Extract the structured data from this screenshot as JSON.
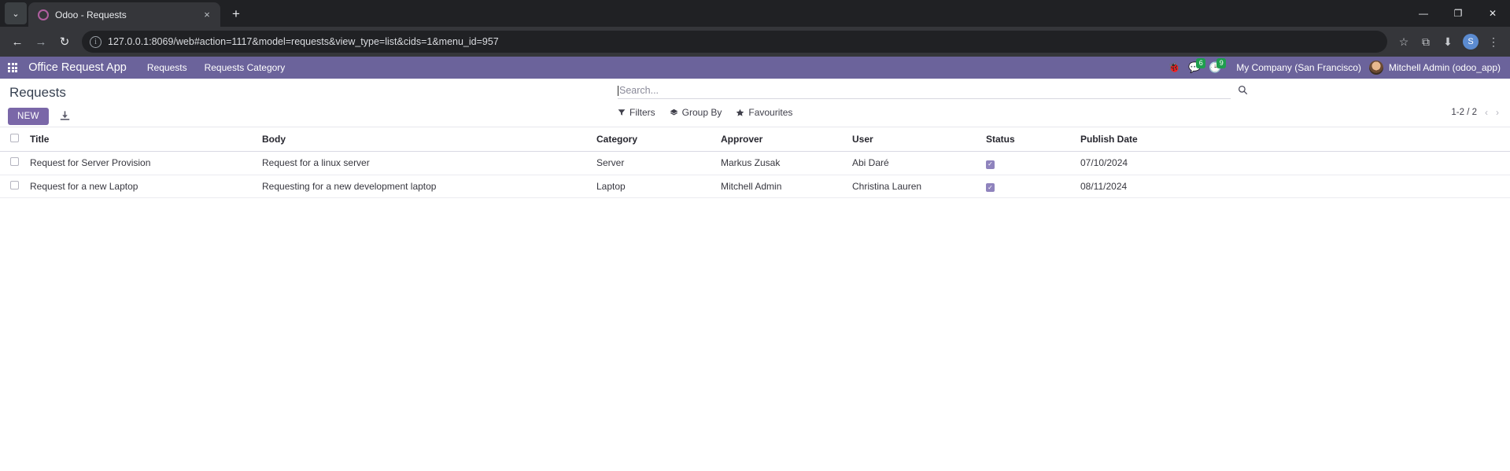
{
  "browser": {
    "tab": {
      "title": "Odoo - Requests",
      "favicon": "odoo-favicon",
      "close": "×"
    },
    "new_tab": "+",
    "tab_list": "⌄",
    "nav": {
      "back": "←",
      "forward": "→",
      "reload": "↻"
    },
    "omnibox": {
      "info_icon": "i",
      "url": "127.0.0.1:8069/web#action=1117&model=requests&view_type=list&cids=1&menu_id=957"
    },
    "toolbar_icons": {
      "bookmark": "☆",
      "extensions": "⧉",
      "download": "⬇"
    },
    "profile_initial": "S",
    "menu": "⋮",
    "window": {
      "minimize": "—",
      "maximize": "❐",
      "close": "✕"
    }
  },
  "navbar": {
    "apps_icon": "apps-grid-icon",
    "brand": "Office Request App",
    "menu_items": [
      "Requests",
      "Requests Category"
    ],
    "sys_icons": [
      {
        "name": "bug-icon",
        "glyph": "🐞",
        "badge": null
      },
      {
        "name": "messages-icon",
        "glyph": "💬",
        "badge": "6"
      },
      {
        "name": "activities-icon",
        "glyph": "🕒",
        "badge": "9"
      }
    ],
    "company": "My Company (San Francisco)",
    "user": "Mitchell Admin (odoo_app)",
    "accent_color": "#6b639b"
  },
  "control_panel": {
    "breadcrumb": "Requests",
    "new_button": "NEW",
    "download_icon": "download-icon",
    "search": {
      "placeholder": "Search...",
      "value": "",
      "icon": "search-icon"
    },
    "filters": [
      {
        "label": "Filters",
        "icon": "funnel-icon"
      },
      {
        "label": "Group By",
        "icon": "layers-icon"
      },
      {
        "label": "Favourites",
        "icon": "star-icon"
      }
    ],
    "pager": {
      "range": "1-2 / 2",
      "prev": "‹",
      "next": "›"
    }
  },
  "list": {
    "columns": [
      "Title",
      "Body",
      "Category",
      "Approver",
      "User",
      "Status",
      "Publish Date"
    ],
    "rows": [
      {
        "selected": false,
        "title": "Request for Server Provision",
        "body": "Request for a linux server",
        "category": "Server",
        "approver": "Markus Zusak",
        "user": "Abi Daré",
        "status": true,
        "publish_date": "07/10/2024"
      },
      {
        "selected": false,
        "title": "Request for a new Laptop",
        "body": "Requesting for a new development laptop",
        "category": "Laptop",
        "approver": "Mitchell Admin",
        "user": "Christina Lauren",
        "status": true,
        "publish_date": "08/11/2024"
      }
    ],
    "check_glyph": "✓"
  }
}
